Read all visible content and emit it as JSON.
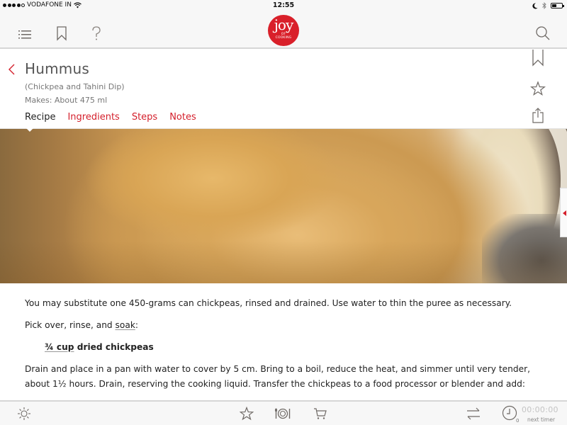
{
  "status_bar": {
    "carrier": "VODAFONE IN",
    "signal_bars_filled": 4,
    "signal_bars_total": 5,
    "time": "12:55",
    "battery_level": 0.45
  },
  "header": {
    "menu_icon": "list-icon",
    "bookmarks_icon": "bookmark-icon",
    "help_icon": "question-icon",
    "logo": {
      "main": "joy",
      "sub1": "OF",
      "sub2": "COOKING"
    },
    "search_icon": "search-icon"
  },
  "recipe": {
    "title": "Hummus",
    "subtitle": "(Chickpea and Tahini Dip)",
    "makes": "Makes: About 475 ml",
    "tabs": [
      {
        "label": "Recipe",
        "active": true
      },
      {
        "label": "Ingredients",
        "active": false
      },
      {
        "label": "Steps",
        "active": false
      },
      {
        "label": "Notes",
        "active": false
      }
    ],
    "actions": [
      "bookmark-icon",
      "star-icon",
      "share-icon"
    ]
  },
  "content": {
    "note": "You may substitute one 450-grams can chickpeas, rinsed and drained. Use water to thin the puree as necessary.",
    "step1_prefix": "Pick over, rinse, and ",
    "step1_link": "soak",
    "step1_suffix": ":",
    "ingredient1_qty": "¾ cup",
    "ingredient1_name": " dried chickpeas",
    "step2": "Drain and place in a pan with water to cover by 5 cm. Bring to a boil, reduce the heat, and simmer until very tender, about 1½ hours. Drain, reserving the cooking liquid. Transfer the chickpeas to a food processor or blender and add:"
  },
  "bottom_bar": {
    "brightness_icon": "sun-icon",
    "favorites_icon": "star-icon",
    "meal_icon": "plate-cutlery-icon",
    "cart_icon": "cart-icon",
    "convert_icon": "swap-arrows-icon",
    "timer_icon": "clock-icon",
    "timer_count": "0",
    "timer_value": "00:00:00",
    "timer_label": "next timer"
  },
  "colors": {
    "accent": "#d41f2b",
    "logo_red": "#d9202a",
    "icon_gray": "#6f6a66",
    "bar_bg": "#f7f7f7"
  }
}
